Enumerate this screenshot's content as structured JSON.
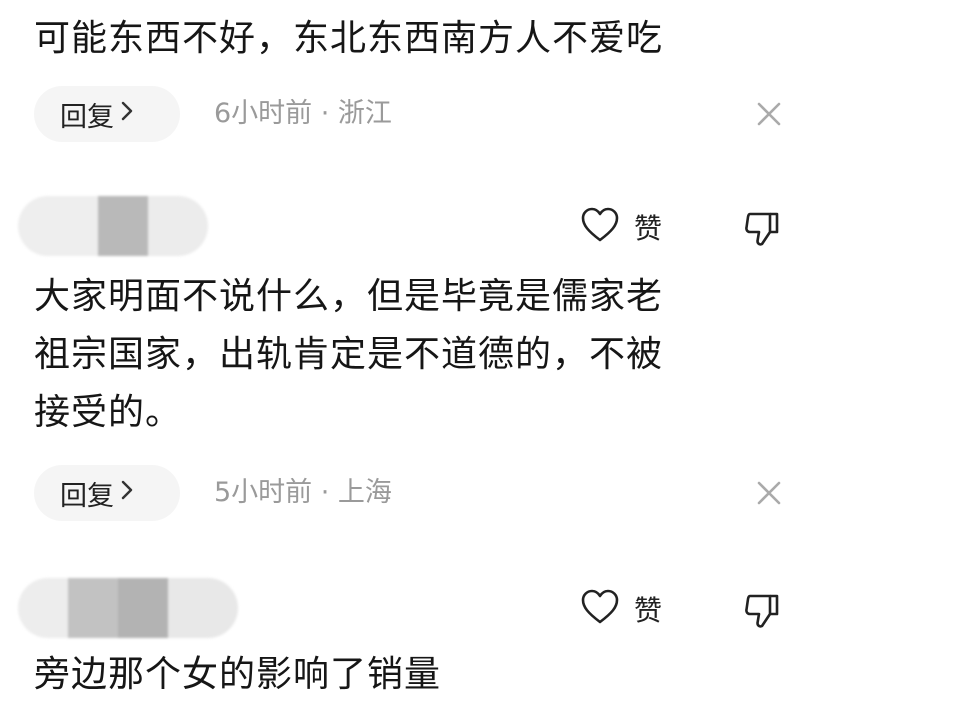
{
  "comments": [
    {
      "text": "可能东西不好，东北东西南方人不爱吃",
      "reply_label": "回复",
      "meta": "6小时前 · 浙江"
    },
    {
      "like_label": "赞",
      "text": "大家明面不说什么，但是毕竟是儒家老\n祖宗国家，出轨肯定是不道德的，不被\n接受的。",
      "reply_label": "回复",
      "meta": "5小时前 · 上海"
    },
    {
      "like_label": "赞",
      "text": "旁边那个女的影响了销量"
    }
  ],
  "icons": {
    "reply_chevron": "chevron-right-icon",
    "close": "close-icon",
    "like": "heart-icon",
    "dislike": "thumbs-down-icon"
  },
  "colors": {
    "text": "#161616",
    "meta": "#9a9a9a",
    "pill_bg": "#f5f5f5",
    "icon": "#222222"
  }
}
